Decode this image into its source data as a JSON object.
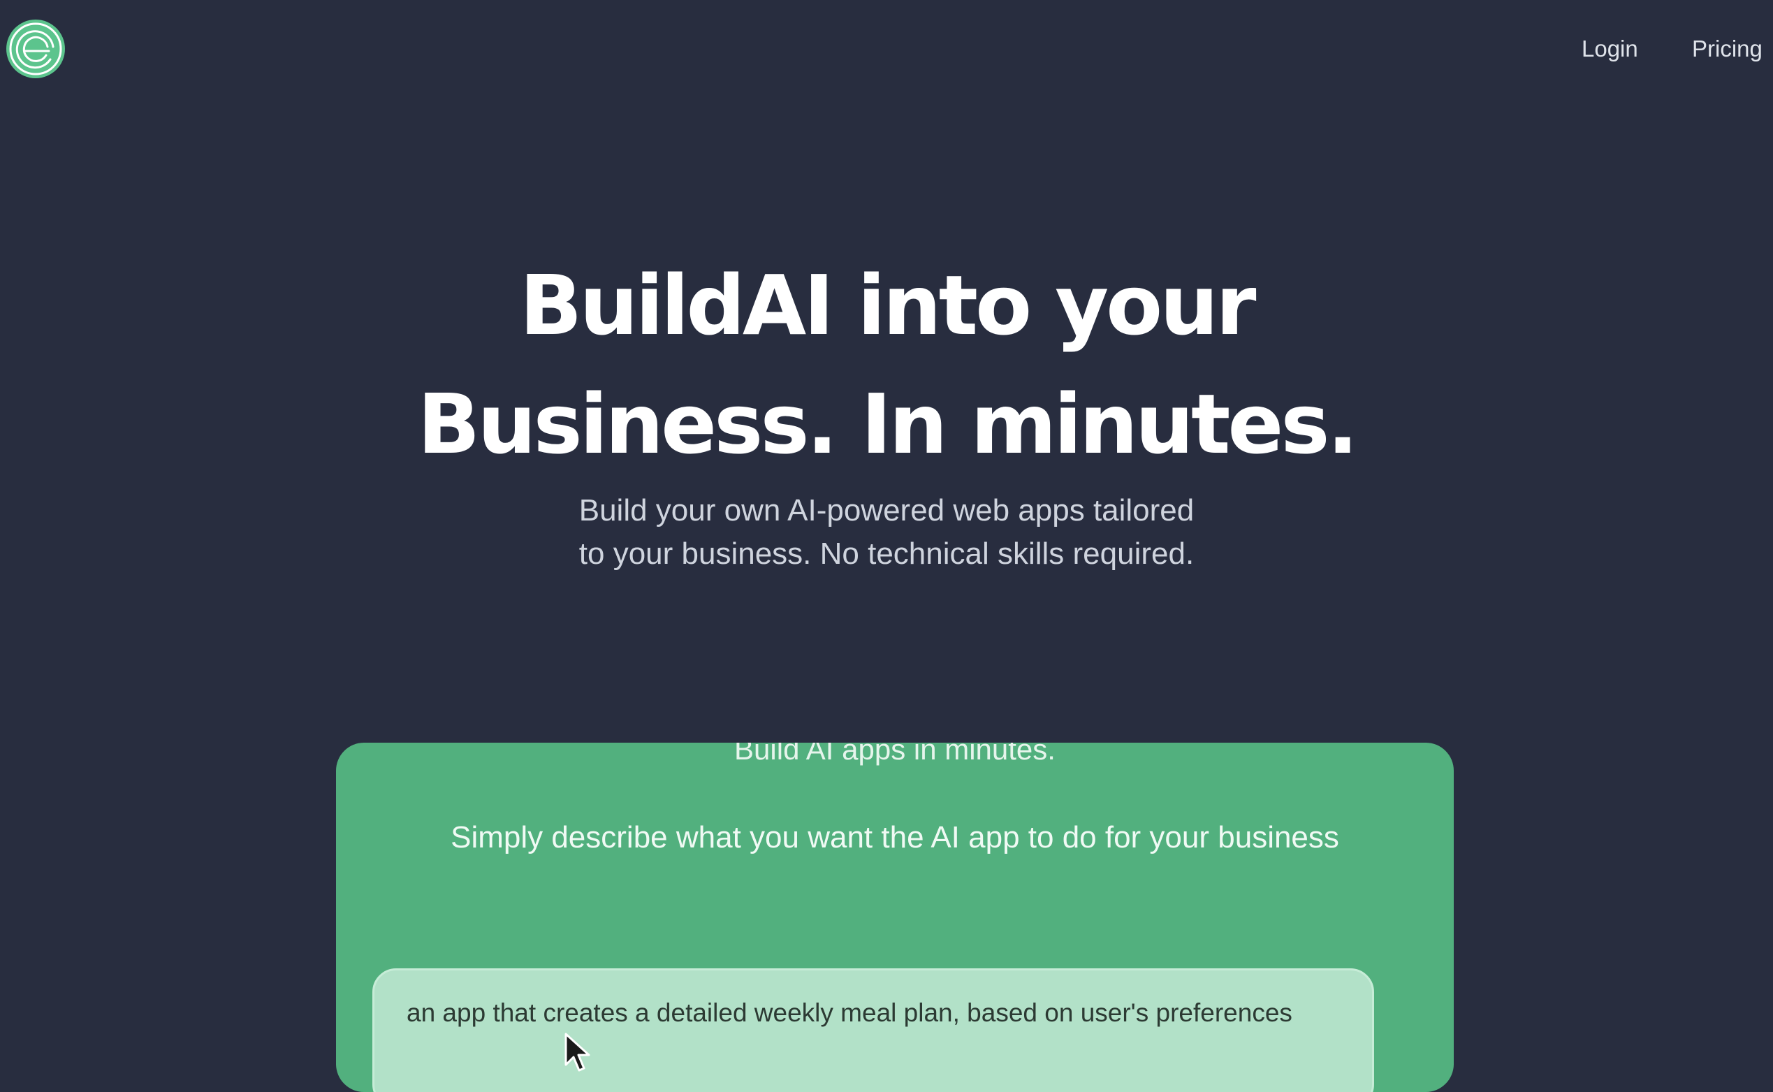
{
  "header": {
    "logo_icon": "buildai-logo-icon",
    "nav": [
      {
        "label": "Login"
      },
      {
        "label": "Pricing"
      }
    ]
  },
  "hero": {
    "title_line1": "BuildAI into your",
    "title_line2": "Business. In minutes.",
    "subtitle_line1": "Build your own AI-powered web apps tailored",
    "subtitle_line2": "to your business. No technical skills required."
  },
  "demo": {
    "heading": "Build AI apps in minutes.",
    "prompt": "Simply describe what you want the AI app to do for your business",
    "input_value": "an app that creates a detailed weekly meal plan, based on user's preferences",
    "cursor_icon": "mouse-pointer-icon"
  },
  "colors": {
    "background": "#282d3f",
    "accent_green": "#52b07e",
    "input_bg": "#b2e1c8"
  }
}
